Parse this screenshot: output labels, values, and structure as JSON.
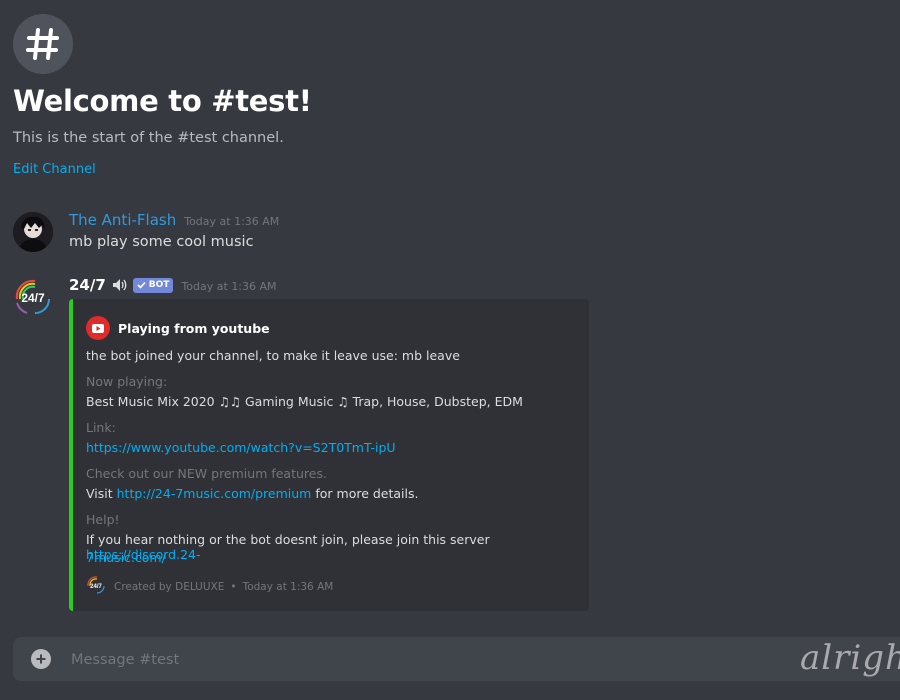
{
  "channel": {
    "welcome_title": "Welcome to #test!",
    "welcome_subtitle": "This is the start of the #test channel.",
    "edit_label": "Edit Channel"
  },
  "messages": [
    {
      "author": "The Anti-Flash",
      "author_color": "#3498db",
      "timestamp": "Today at 1:36 AM",
      "text": "mb play some cool music"
    },
    {
      "author": "24/7",
      "bot_badge": "BOT",
      "timestamp": "Today at 1:36 AM",
      "avatar_text": "24/7",
      "embed": {
        "accent_color": "#2ecc1f",
        "author_name": "Playing from youtube",
        "description": "the bot joined your channel, to make it leave use: mb leave",
        "now_playing_label": "Now playing:",
        "now_playing_value": "Best Music Mix 2020 ♫♫ Gaming Music ♫ Trap, House, Dubstep, EDM",
        "link_label": "Link:",
        "link_value": "https://www.youtube.com/watch?v=S2T0TmT-ipU",
        "premium_label": "Check out our NEW premium features.",
        "premium_prefix": "Visit",
        "premium_link": "http://24-7music.com/premium",
        "premium_suffix": "for more details.",
        "help_label": "Help!",
        "help_text": "If you hear nothing or the bot doesnt join, please join this server",
        "help_link_line1": "https://discord.24-",
        "help_link_line2": "7music.com/",
        "footer_text": "Created by DELUUXE",
        "footer_separator": "•",
        "footer_timestamp": "Today at 1:36 AM"
      }
    }
  ],
  "composer": {
    "placeholder": "Message #test"
  },
  "watermark": "alrigh"
}
